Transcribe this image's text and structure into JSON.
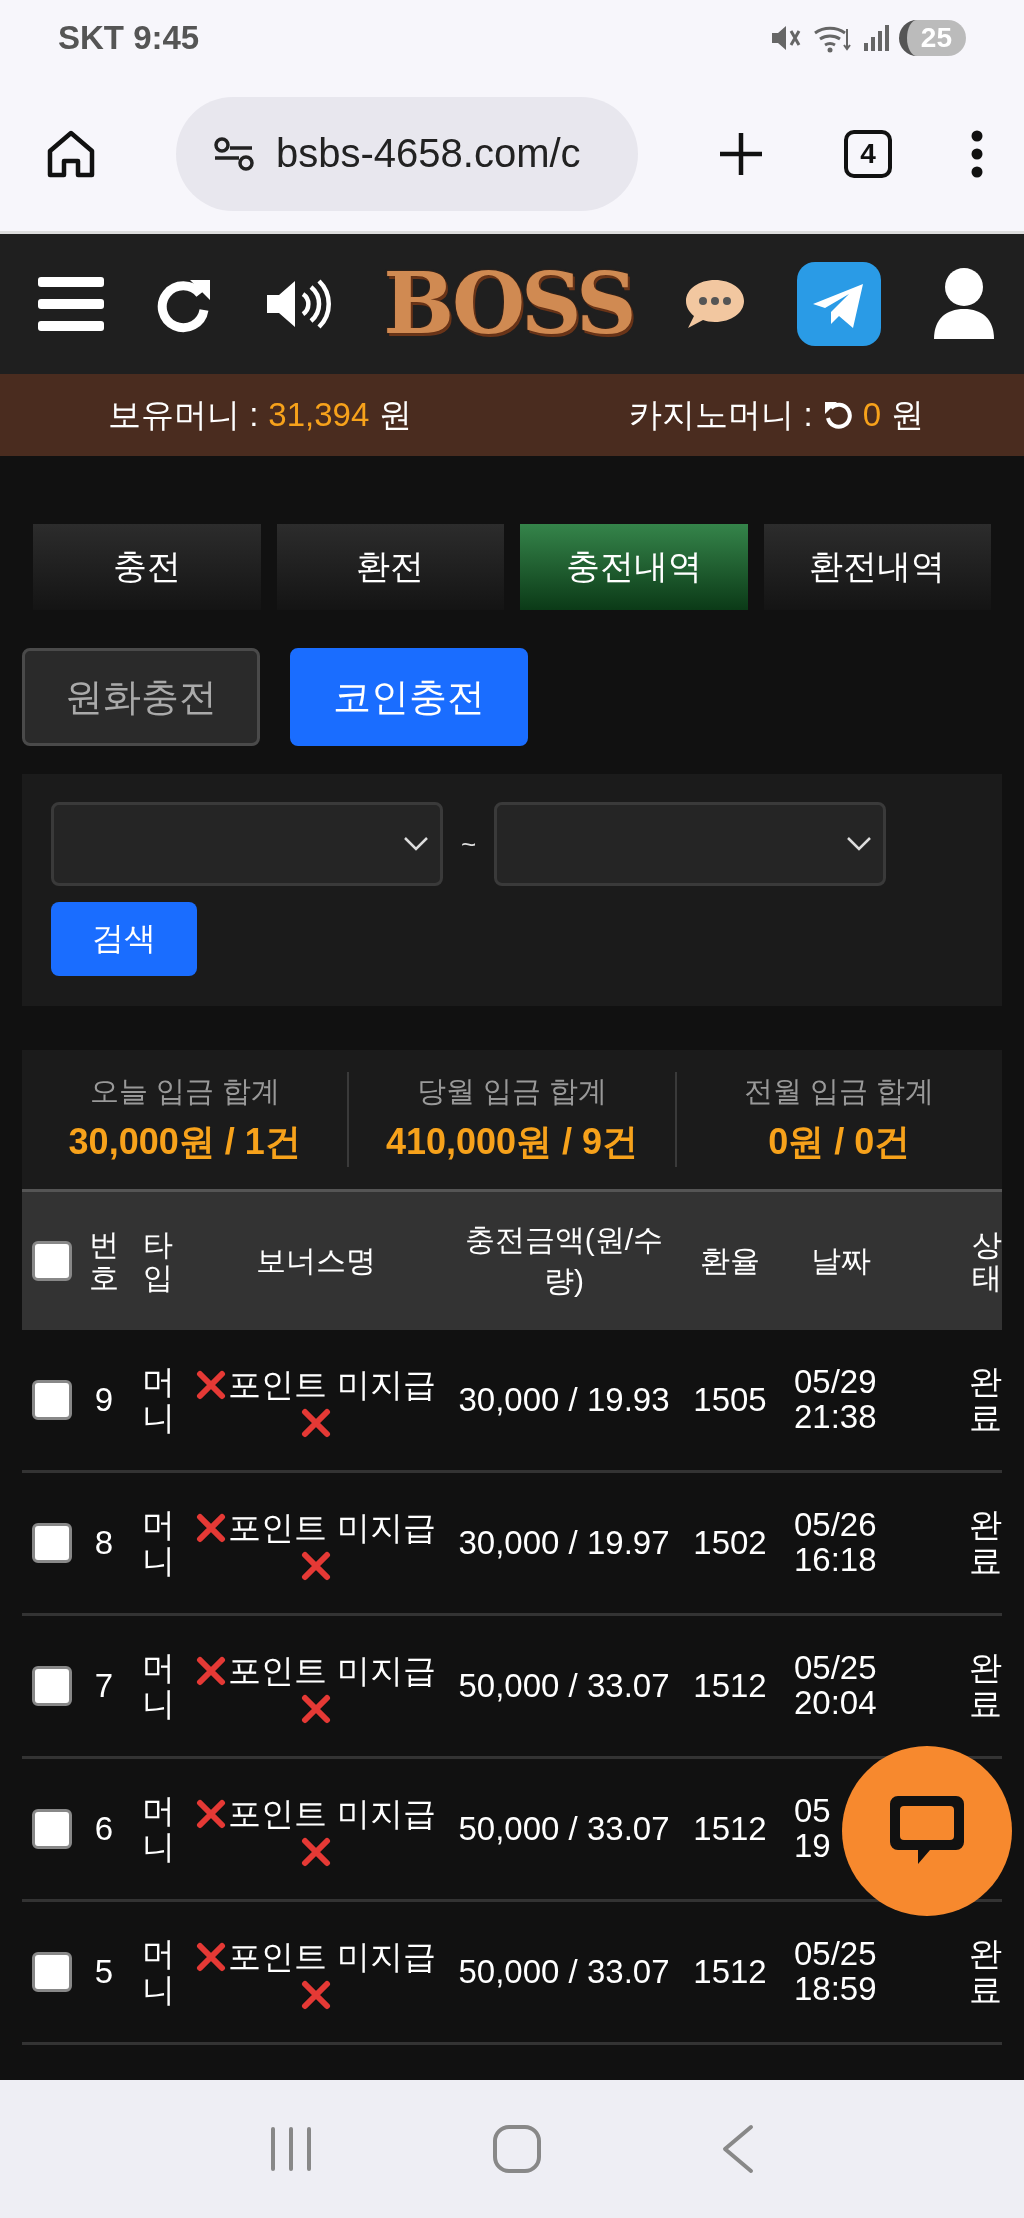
{
  "status_bar": {
    "carrier_time": "SKT 9:45",
    "battery": "25"
  },
  "browser": {
    "url": "bsbs-4658.com/c",
    "tab_count": "4"
  },
  "site_header": {
    "logo": "BOSS"
  },
  "balance": {
    "money_label": "보유머니 :",
    "money_value": "31,394",
    "money_unit": "원",
    "casino_label": "카지노머니 :",
    "casino_value": "0",
    "casino_unit": "원"
  },
  "tabs": [
    {
      "label": "충전",
      "selected": false
    },
    {
      "label": "환전",
      "selected": false
    },
    {
      "label": "충전내역",
      "selected": true
    },
    {
      "label": "환전내역",
      "selected": false
    }
  ],
  "sub_tabs": [
    {
      "label": "원화충전",
      "selected": false
    },
    {
      "label": "코인충전",
      "selected": true
    }
  ],
  "filter": {
    "separator": "~",
    "search_button": "검색"
  },
  "summary": [
    {
      "label": "오늘 입금 합계",
      "value": "30,000원 / 1건"
    },
    {
      "label": "당월 입금 합계",
      "value": "410,000원 / 9건"
    },
    {
      "label": "전월 입금 합계",
      "value": "0원 / 0건"
    }
  ],
  "table": {
    "select_all_checked": false,
    "columns": [
      "번호",
      "타입",
      "보너스명",
      "충전금액(원/수량)",
      "환율",
      "날짜",
      "상태"
    ],
    "rows": [
      {
        "checked": false,
        "number": "9",
        "type": "머니",
        "bonus": "포인트 미지급",
        "amount": "30,000 / 19.93",
        "rate": "1505",
        "date": "05/29",
        "time": "21:38",
        "status": "완료"
      },
      {
        "checked": false,
        "number": "8",
        "type": "머니",
        "bonus": "포인트 미지급",
        "amount": "30,000 / 19.97",
        "rate": "1502",
        "date": "05/26",
        "time": "16:18",
        "status": "완료"
      },
      {
        "checked": false,
        "number": "7",
        "type": "머니",
        "bonus": "포인트 미지급",
        "amount": "50,000 / 33.07",
        "rate": "1512",
        "date": "05/25",
        "time": "20:04",
        "status": "완료"
      },
      {
        "checked": false,
        "number": "6",
        "type": "머니",
        "bonus": "포인트 미지급",
        "amount": "50,000 / 33.07",
        "rate": "1512",
        "date": "05",
        "time": "19",
        "status": ""
      },
      {
        "checked": false,
        "number": "5",
        "type": "머니",
        "bonus": "포인트 미지급",
        "amount": "50,000 / 33.07",
        "rate": "1512",
        "date": "05/25",
        "time": "18:59",
        "status": "완료"
      }
    ]
  }
}
